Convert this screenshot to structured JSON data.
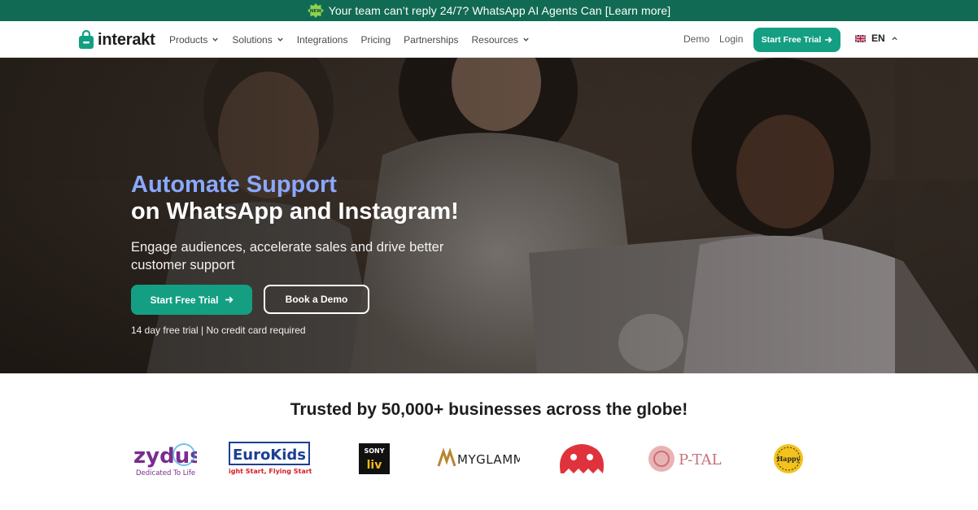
{
  "announcement": {
    "badge": "NEW",
    "text": "Your team can’t reply 24/7? WhatsApp AI Agents Can [Learn more]"
  },
  "nav": {
    "brand": "interakt",
    "menu": [
      {
        "label": "Products",
        "dropdown": true
      },
      {
        "label": "Solutions",
        "dropdown": true
      },
      {
        "label": "Integrations",
        "dropdown": false
      },
      {
        "label": "Pricing",
        "dropdown": false
      },
      {
        "label": "Partnerships",
        "dropdown": false
      },
      {
        "label": "Resources",
        "dropdown": true
      }
    ],
    "demo": "Demo",
    "login": "Login",
    "cta": "Start Free Trial",
    "language": "EN"
  },
  "hero": {
    "title_highlight": "Automate Support",
    "title_rest": "on WhatsApp and Instagram!",
    "subtitle": "Engage audiences, accelerate sales and drive better customer support",
    "primary_cta": "Start Free Trial",
    "secondary_cta": "Book a Demo",
    "note": "14 day free trial | No credit card required"
  },
  "trusted": {
    "title": "Trusted by 50,000+ businesses across the globe!",
    "logos": [
      {
        "name": "zydus",
        "text": "zydus",
        "tagline": "Dedicated To Life"
      },
      {
        "name": "eurokids",
        "text": "EuroKids",
        "tagline": "Right Start, Flying Start!"
      },
      {
        "name": "sonyliv",
        "text": "SONY",
        "sub": "liv"
      },
      {
        "name": "myglamm",
        "text": "MYGLAMM"
      },
      {
        "name": "souled-store",
        "text": "The Souled Store"
      },
      {
        "name": "ptal",
        "text": "P-TAL"
      },
      {
        "name": "happy",
        "text": "Happy"
      }
    ]
  },
  "colors": {
    "brand_green": "#149f83",
    "announce_bg": "#116a53",
    "hero_highlight": "#8aa8ff"
  }
}
